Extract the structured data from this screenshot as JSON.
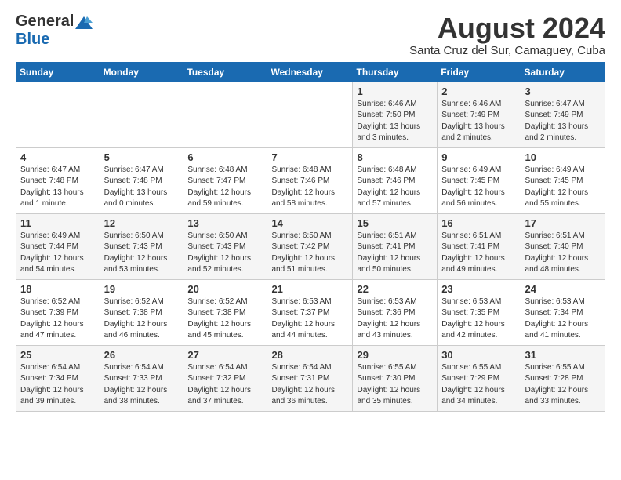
{
  "logo": {
    "general": "General",
    "blue": "Blue"
  },
  "title": "August 2024",
  "subtitle": "Santa Cruz del Sur, Camaguey, Cuba",
  "days_header": [
    "Sunday",
    "Monday",
    "Tuesday",
    "Wednesday",
    "Thursday",
    "Friday",
    "Saturday"
  ],
  "weeks": [
    [
      {
        "day": "",
        "info": ""
      },
      {
        "day": "",
        "info": ""
      },
      {
        "day": "",
        "info": ""
      },
      {
        "day": "",
        "info": ""
      },
      {
        "day": "1",
        "info": "Sunrise: 6:46 AM\nSunset: 7:50 PM\nDaylight: 13 hours\nand 3 minutes."
      },
      {
        "day": "2",
        "info": "Sunrise: 6:46 AM\nSunset: 7:49 PM\nDaylight: 13 hours\nand 2 minutes."
      },
      {
        "day": "3",
        "info": "Sunrise: 6:47 AM\nSunset: 7:49 PM\nDaylight: 13 hours\nand 2 minutes."
      }
    ],
    [
      {
        "day": "4",
        "info": "Sunrise: 6:47 AM\nSunset: 7:48 PM\nDaylight: 13 hours\nand 1 minute."
      },
      {
        "day": "5",
        "info": "Sunrise: 6:47 AM\nSunset: 7:48 PM\nDaylight: 13 hours\nand 0 minutes."
      },
      {
        "day": "6",
        "info": "Sunrise: 6:48 AM\nSunset: 7:47 PM\nDaylight: 12 hours\nand 59 minutes."
      },
      {
        "day": "7",
        "info": "Sunrise: 6:48 AM\nSunset: 7:46 PM\nDaylight: 12 hours\nand 58 minutes."
      },
      {
        "day": "8",
        "info": "Sunrise: 6:48 AM\nSunset: 7:46 PM\nDaylight: 12 hours\nand 57 minutes."
      },
      {
        "day": "9",
        "info": "Sunrise: 6:49 AM\nSunset: 7:45 PM\nDaylight: 12 hours\nand 56 minutes."
      },
      {
        "day": "10",
        "info": "Sunrise: 6:49 AM\nSunset: 7:45 PM\nDaylight: 12 hours\nand 55 minutes."
      }
    ],
    [
      {
        "day": "11",
        "info": "Sunrise: 6:49 AM\nSunset: 7:44 PM\nDaylight: 12 hours\nand 54 minutes."
      },
      {
        "day": "12",
        "info": "Sunrise: 6:50 AM\nSunset: 7:43 PM\nDaylight: 12 hours\nand 53 minutes."
      },
      {
        "day": "13",
        "info": "Sunrise: 6:50 AM\nSunset: 7:43 PM\nDaylight: 12 hours\nand 52 minutes."
      },
      {
        "day": "14",
        "info": "Sunrise: 6:50 AM\nSunset: 7:42 PM\nDaylight: 12 hours\nand 51 minutes."
      },
      {
        "day": "15",
        "info": "Sunrise: 6:51 AM\nSunset: 7:41 PM\nDaylight: 12 hours\nand 50 minutes."
      },
      {
        "day": "16",
        "info": "Sunrise: 6:51 AM\nSunset: 7:41 PM\nDaylight: 12 hours\nand 49 minutes."
      },
      {
        "day": "17",
        "info": "Sunrise: 6:51 AM\nSunset: 7:40 PM\nDaylight: 12 hours\nand 48 minutes."
      }
    ],
    [
      {
        "day": "18",
        "info": "Sunrise: 6:52 AM\nSunset: 7:39 PM\nDaylight: 12 hours\nand 47 minutes."
      },
      {
        "day": "19",
        "info": "Sunrise: 6:52 AM\nSunset: 7:38 PM\nDaylight: 12 hours\nand 46 minutes."
      },
      {
        "day": "20",
        "info": "Sunrise: 6:52 AM\nSunset: 7:38 PM\nDaylight: 12 hours\nand 45 minutes."
      },
      {
        "day": "21",
        "info": "Sunrise: 6:53 AM\nSunset: 7:37 PM\nDaylight: 12 hours\nand 44 minutes."
      },
      {
        "day": "22",
        "info": "Sunrise: 6:53 AM\nSunset: 7:36 PM\nDaylight: 12 hours\nand 43 minutes."
      },
      {
        "day": "23",
        "info": "Sunrise: 6:53 AM\nSunset: 7:35 PM\nDaylight: 12 hours\nand 42 minutes."
      },
      {
        "day": "24",
        "info": "Sunrise: 6:53 AM\nSunset: 7:34 PM\nDaylight: 12 hours\nand 41 minutes."
      }
    ],
    [
      {
        "day": "25",
        "info": "Sunrise: 6:54 AM\nSunset: 7:34 PM\nDaylight: 12 hours\nand 39 minutes."
      },
      {
        "day": "26",
        "info": "Sunrise: 6:54 AM\nSunset: 7:33 PM\nDaylight: 12 hours\nand 38 minutes."
      },
      {
        "day": "27",
        "info": "Sunrise: 6:54 AM\nSunset: 7:32 PM\nDaylight: 12 hours\nand 37 minutes."
      },
      {
        "day": "28",
        "info": "Sunrise: 6:54 AM\nSunset: 7:31 PM\nDaylight: 12 hours\nand 36 minutes."
      },
      {
        "day": "29",
        "info": "Sunrise: 6:55 AM\nSunset: 7:30 PM\nDaylight: 12 hours\nand 35 minutes."
      },
      {
        "day": "30",
        "info": "Sunrise: 6:55 AM\nSunset: 7:29 PM\nDaylight: 12 hours\nand 34 minutes."
      },
      {
        "day": "31",
        "info": "Sunrise: 6:55 AM\nSunset: 7:28 PM\nDaylight: 12 hours\nand 33 minutes."
      }
    ]
  ]
}
